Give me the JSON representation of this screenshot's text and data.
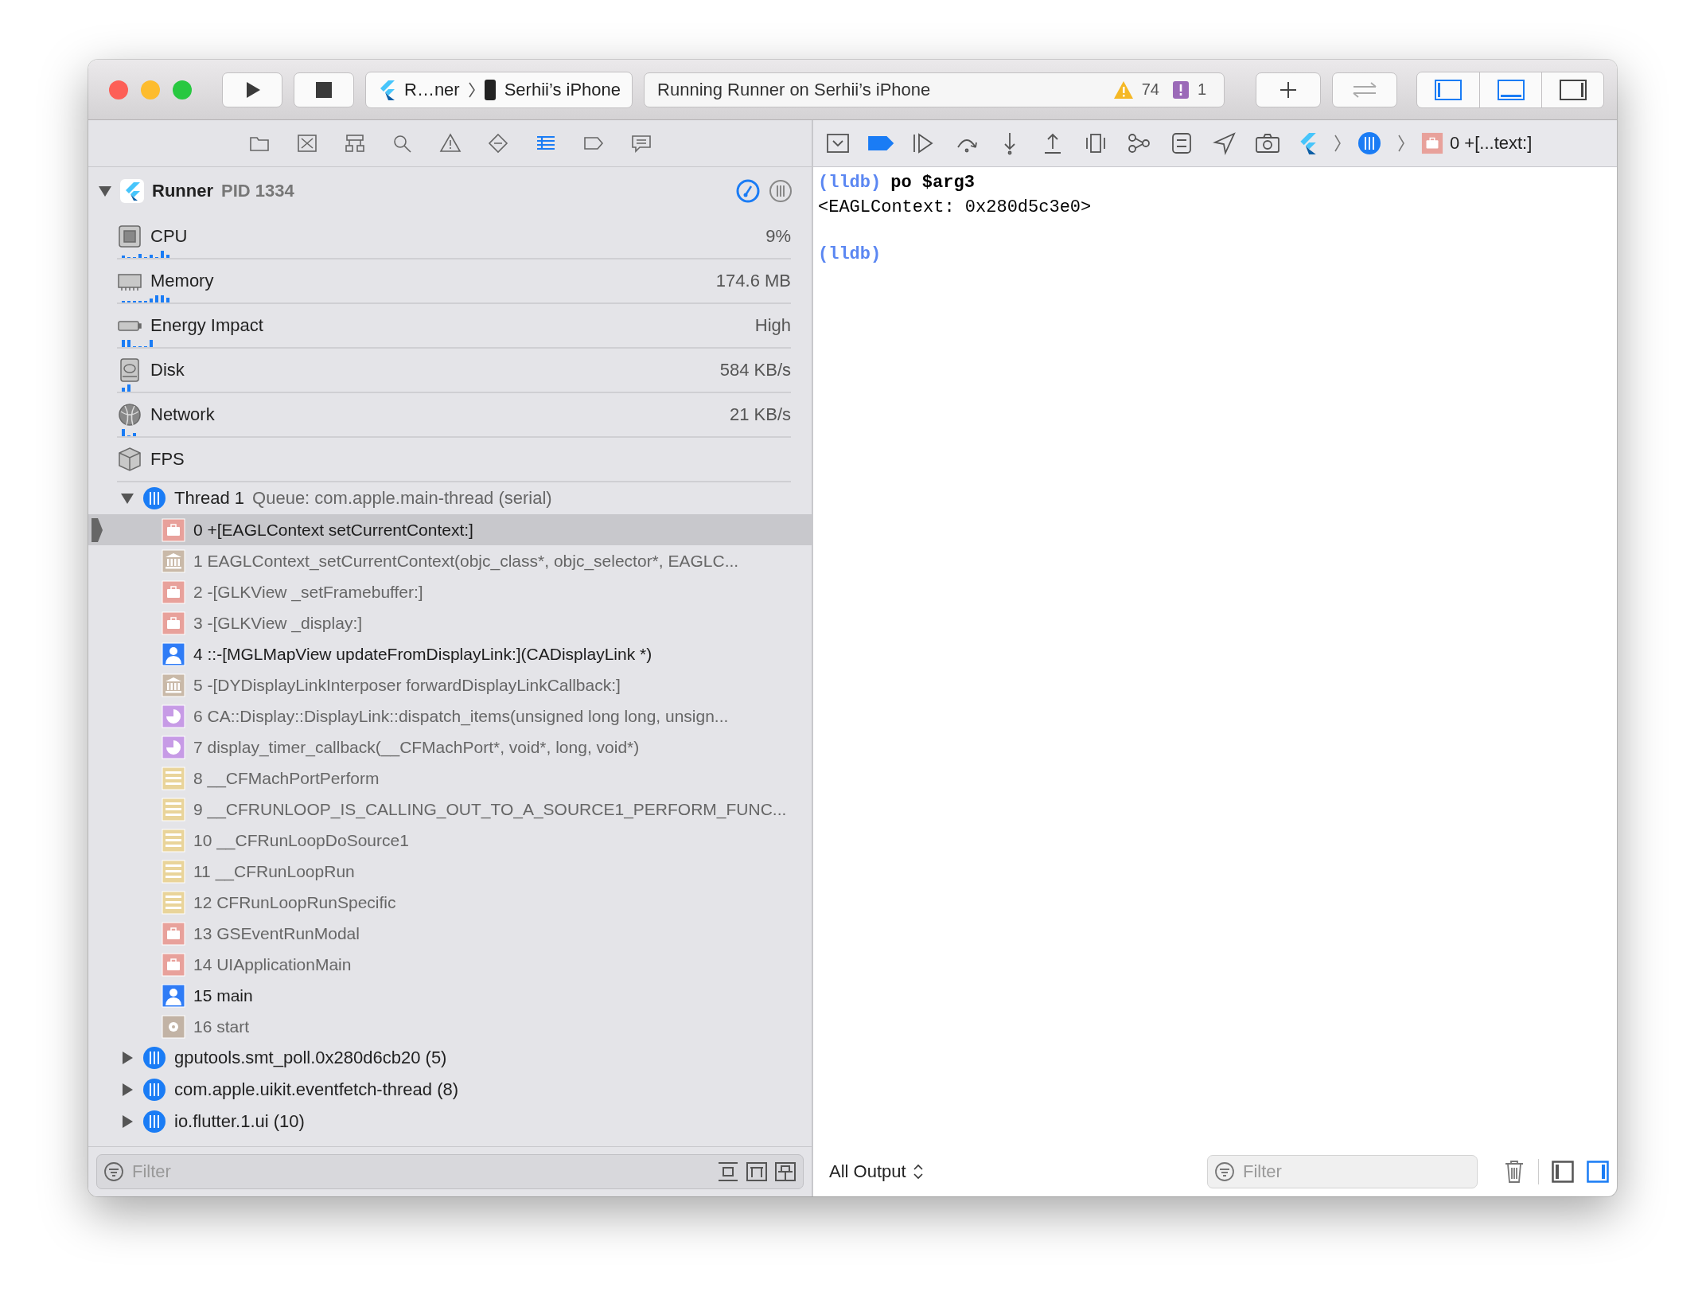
{
  "toolbar": {
    "scheme": {
      "app": "R…ner",
      "device": "Serhii’s iPhone"
    },
    "activity": {
      "status": "Running Runner on Serhii’s iPhone",
      "warnings": "74",
      "errors": "1"
    },
    "panel_toggles": [
      {
        "selected": true
      },
      {
        "selected": true
      },
      {
        "selected": false
      }
    ]
  },
  "navigator_tabs": [
    {
      "selected": false
    },
    {
      "selected": false
    },
    {
      "selected": false
    },
    {
      "selected": false
    },
    {
      "selected": false
    },
    {
      "selected": false
    },
    {
      "selected": true
    },
    {
      "selected": false
    },
    {
      "selected": false
    }
  ],
  "process": {
    "name": "Runner",
    "pid": "PID 1334",
    "expanded": true
  },
  "gauges": [
    {
      "kind": "cpu",
      "name": "CPU",
      "value": "9%"
    },
    {
      "kind": "memory",
      "name": "Memory",
      "value": "174.6 MB"
    },
    {
      "kind": "energy",
      "name": "Energy Impact",
      "value": "High"
    },
    {
      "kind": "disk",
      "name": "Disk",
      "value": "584 KB/s"
    },
    {
      "kind": "network",
      "name": "Network",
      "value": "21 KB/s"
    },
    {
      "kind": "fps",
      "name": "FPS"
    }
  ],
  "threads": [
    {
      "name": "Thread 1",
      "queue": "Queue: com.apple.main-thread (serial)",
      "expanded": true,
      "frames": [
        {
          "kind": "objc",
          "text": "0 +[EAGLContext setCurrentContext:]",
          "selected": true
        },
        {
          "kind": "library",
          "text": "1 EAGLContext_setCurrentContext(objc_class*, objc_selector*, EAGLC...",
          "selected": false
        },
        {
          "kind": "objc",
          "text": "2 -[GLKView _setFramebuffer:]",
          "selected": false
        },
        {
          "kind": "objc",
          "text": "3 -[GLKView _display:]",
          "selected": false
        },
        {
          "kind": "user",
          "text": "4 ::-[MGLMapView updateFromDisplayLink:](CADisplayLink *)",
          "selected": false
        },
        {
          "kind": "library",
          "text": "5 -[DYDisplayLinkInterposer forwardDisplayLinkCallback:]",
          "selected": false
        },
        {
          "kind": "coreanimation",
          "text": "6 CA::Display::DisplayLink::dispatch_items(unsigned long long, unsign...",
          "selected": false
        },
        {
          "kind": "coreanimation",
          "text": "7 display_timer_callback(__CFMachPort*, void*, long, void*)",
          "selected": false
        },
        {
          "kind": "corefoundation",
          "text": "8 __CFMachPortPerform",
          "selected": false
        },
        {
          "kind": "corefoundation",
          "text": "9 __CFRUNLOOP_IS_CALLING_OUT_TO_A_SOURCE1_PERFORM_FUNC...",
          "selected": false
        },
        {
          "kind": "corefoundation",
          "text": "10 __CFRunLoopDoSource1",
          "selected": false
        },
        {
          "kind": "corefoundation",
          "text": "11 __CFRunLoopRun",
          "selected": false
        },
        {
          "kind": "corefoundation",
          "text": "12 CFRunLoopRunSpecific",
          "selected": false
        },
        {
          "kind": "objc",
          "text": "13 GSEventRunModal",
          "selected": false
        },
        {
          "kind": "objc",
          "text": "14 UIApplicationMain",
          "selected": false
        },
        {
          "kind": "user",
          "text": "15 main",
          "selected": false
        },
        {
          "kind": "system",
          "text": "16 start",
          "selected": false
        }
      ]
    },
    {
      "name": "gputools.smt_poll.0x280d6cb20 (5)",
      "expanded": false
    },
    {
      "name": "com.apple.uikit.eventfetch-thread (8)",
      "expanded": false
    },
    {
      "name": "io.flutter.1.ui (10)",
      "expanded": false
    }
  ],
  "navigator_filter": {
    "placeholder": "Filter"
  },
  "debug_bar": {
    "breakpoints_active": true,
    "breadcrumb": "0 +[...text:]"
  },
  "console": {
    "lines": [
      {
        "kind": "command",
        "prompt": "(lldb)",
        "text": "po $arg3"
      },
      {
        "kind": "output",
        "text": "<EAGLContext: 0x280d5c3e0>"
      },
      {
        "kind": "command",
        "prompt": "(lldb)"
      }
    ]
  },
  "output_selector": "All Output",
  "console_filter": {
    "placeholder": "Filter"
  },
  "console_toggles": [
    {
      "selected": false
    },
    {
      "selected": true
    }
  ]
}
